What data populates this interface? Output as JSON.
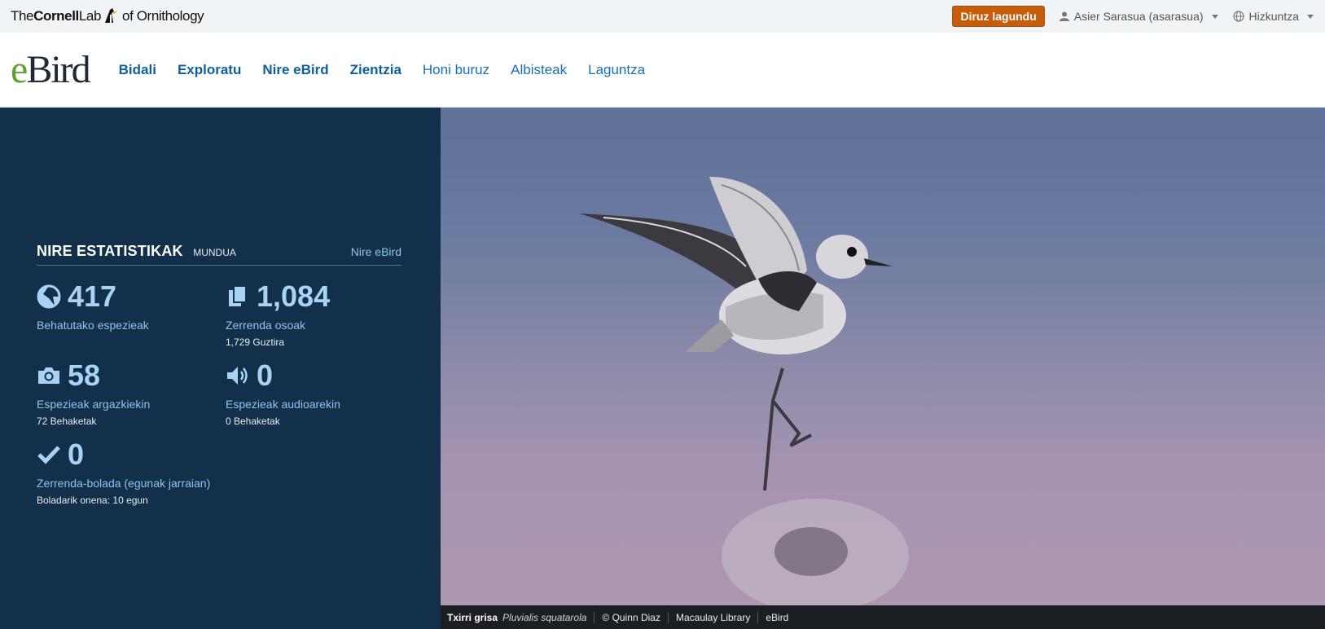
{
  "topbar": {
    "logo": {
      "the": "The",
      "cornell": "Cornell",
      "lab": "Lab",
      "of": "of Ornithology"
    },
    "donate_label": "Diruz lagundu",
    "user_label": "Asier Sarasua (asarasua)",
    "language_label": "Hizkuntza",
    "icons": {
      "user": "user-icon",
      "language": "globe-icon",
      "dropdown": "caret-down-icon"
    }
  },
  "navbar": {
    "logo_e": "e",
    "logo_bird": "Bird",
    "links": [
      "Bidali",
      "Exploratu",
      "Nire eBird",
      "Zientzia",
      "Honi buruz",
      "Albisteak",
      "Laguntza"
    ]
  },
  "stats": {
    "title": "NIRE ESTATISTIKAK",
    "region": "MUNDUA",
    "link": "Nire eBird",
    "items": [
      {
        "icon": "species-icon",
        "value": "417",
        "label": "Behatutako espezieak",
        "sub": ""
      },
      {
        "icon": "checklist-icon",
        "value": "1,084",
        "label": "Zerrenda osoak",
        "sub": "1,729 Guztira"
      },
      {
        "icon": "camera-icon",
        "value": "58",
        "label": "Espezieak argazkiekin",
        "sub": "72 Behaketak"
      },
      {
        "icon": "audio-icon",
        "value": "0",
        "label": "Espezieak audioarekin",
        "sub": "0 Behaketak"
      },
      {
        "icon": "checkmark-icon",
        "value": "0",
        "label": "Zerrenda-bolada (egunak jarraian)",
        "sub": "Boladarik onena: 10 egun"
      }
    ]
  },
  "photo": {
    "common_name": "Txirri grisa",
    "scientific_name": "Pluvialis squatarola",
    "credit": "© Quinn Diaz",
    "library": "Macaulay Library",
    "source": "eBird"
  },
  "colors": {
    "panel_bg": "#12304a",
    "stat_value": "#a8d3f5",
    "stat_label": "#8fc3ec",
    "donate": "#c55d0a",
    "nav_link": "#1a6fb3",
    "ebird_green": "#5aa12d"
  }
}
